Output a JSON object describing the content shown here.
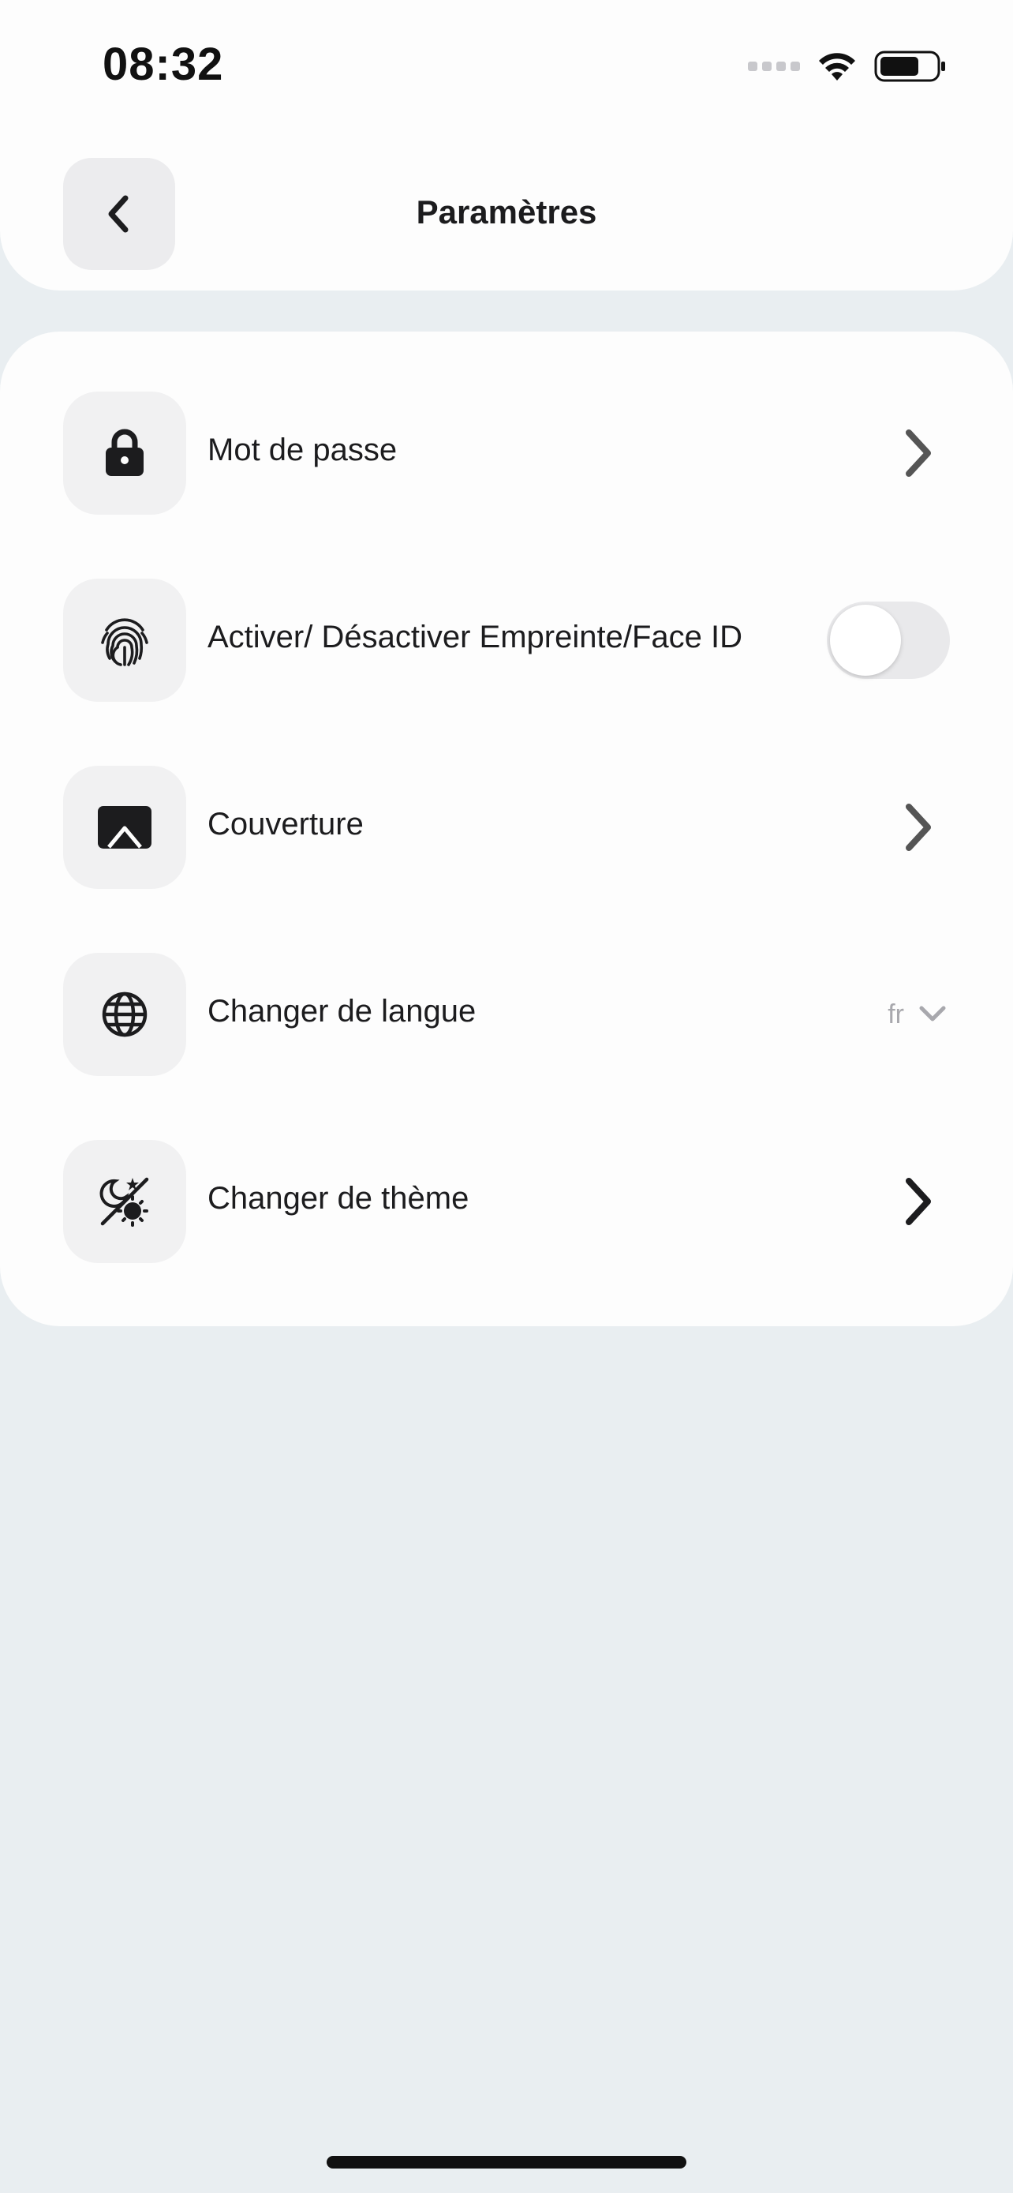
{
  "status_bar": {
    "time": "08:32",
    "icons": [
      "cellular-signal-icon",
      "wifi-icon",
      "battery-icon"
    ]
  },
  "header": {
    "title": "Paramètres",
    "back_icon": "chevron-left-icon"
  },
  "settings": {
    "items": [
      {
        "label": "Mot de passe",
        "icon": "lock-icon",
        "control": "chevron-right"
      },
      {
        "label": "Activer/ Désactiver Empreinte/Face ID",
        "icon": "fingerprint-icon",
        "control": "toggle",
        "toggle_on": false
      },
      {
        "label": "Couverture",
        "icon": "image-icon",
        "control": "chevron-right"
      },
      {
        "label": "Changer de langue",
        "icon": "globe-icon",
        "control": "select",
        "selected_value": "fr"
      },
      {
        "label": "Changer de thème",
        "icon": "theme-icon",
        "control": "chevron-right"
      }
    ]
  },
  "colors": {
    "background": "#e9eef1",
    "card": "#fdfdfd",
    "icon_box": "#f1f1f2",
    "toggle_off": "#e9e9eb",
    "chevron": "#555555",
    "muted_text": "#a8a8ad"
  }
}
